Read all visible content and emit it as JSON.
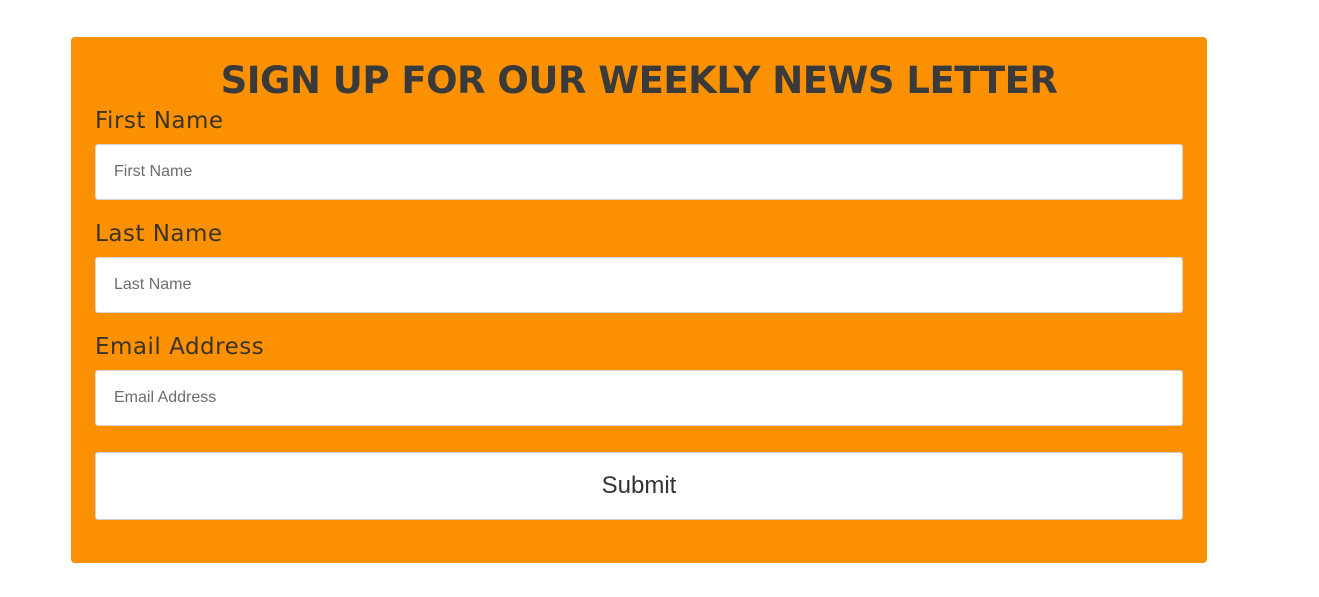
{
  "form": {
    "title": "SIGN UP FOR OUR WEEKLY NEWS LETTER",
    "fields": [
      {
        "label": "First Name",
        "placeholder": "First Name",
        "value": ""
      },
      {
        "label": "Last Name",
        "placeholder": "Last Name",
        "value": ""
      },
      {
        "label": "Email Address",
        "placeholder": "Email Address",
        "value": ""
      }
    ],
    "submit_label": "Submit"
  },
  "colors": {
    "panel_background": "#fb9100",
    "title_text": "#3a3a3a",
    "label_text": "#3b3326",
    "input_background": "#ffffff",
    "page_background": "#ffffff"
  }
}
